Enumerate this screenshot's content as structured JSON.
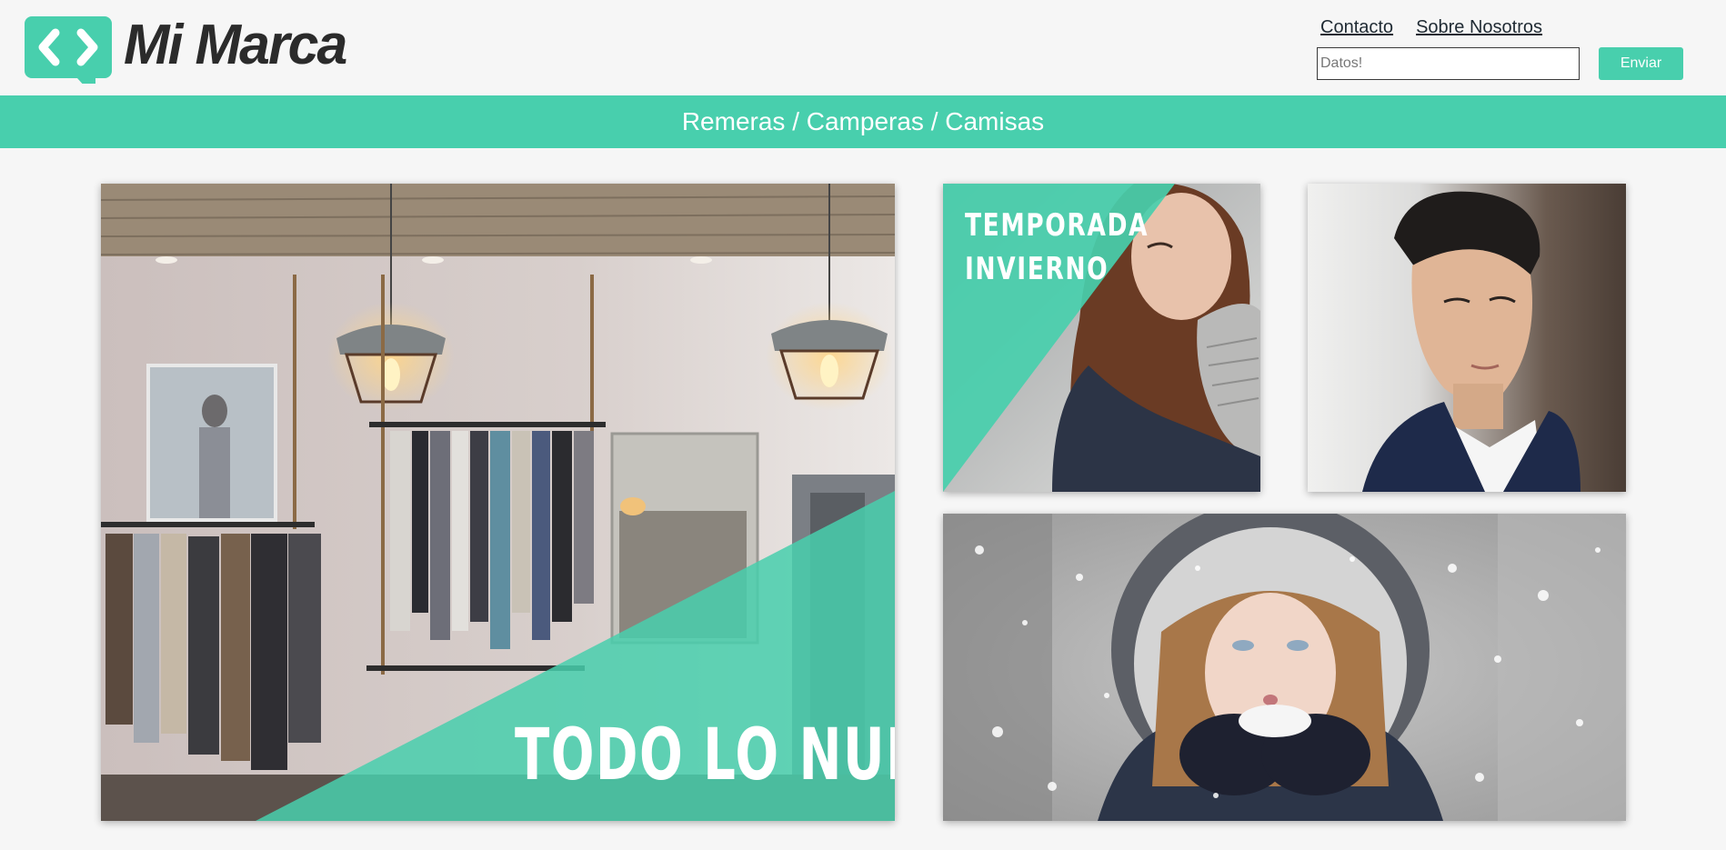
{
  "brand": {
    "name": "Mi Marca",
    "logo_icon": "chevron-brackets-speech-bubble-icon",
    "accent": "#48cfad"
  },
  "nav": {
    "links": [
      "Contacto",
      "Sobre Nosotros"
    ]
  },
  "search": {
    "placeholder": "Datos!",
    "value": "",
    "button_label": "Enviar"
  },
  "categories": {
    "label": "Remeras / Camperas / Camisas"
  },
  "gallery": {
    "main": {
      "caption": "TODO LO NUEVO",
      "image": "clothing-store-interior"
    },
    "top_left": {
      "caption_line1": "TEMPORADA",
      "caption_line2": "INVIERNO",
      "image": "woman-winter-gloves"
    },
    "top_right": {
      "image": "young-man-portrait"
    },
    "bottom": {
      "image": "woman-fur-hood-snow"
    }
  }
}
